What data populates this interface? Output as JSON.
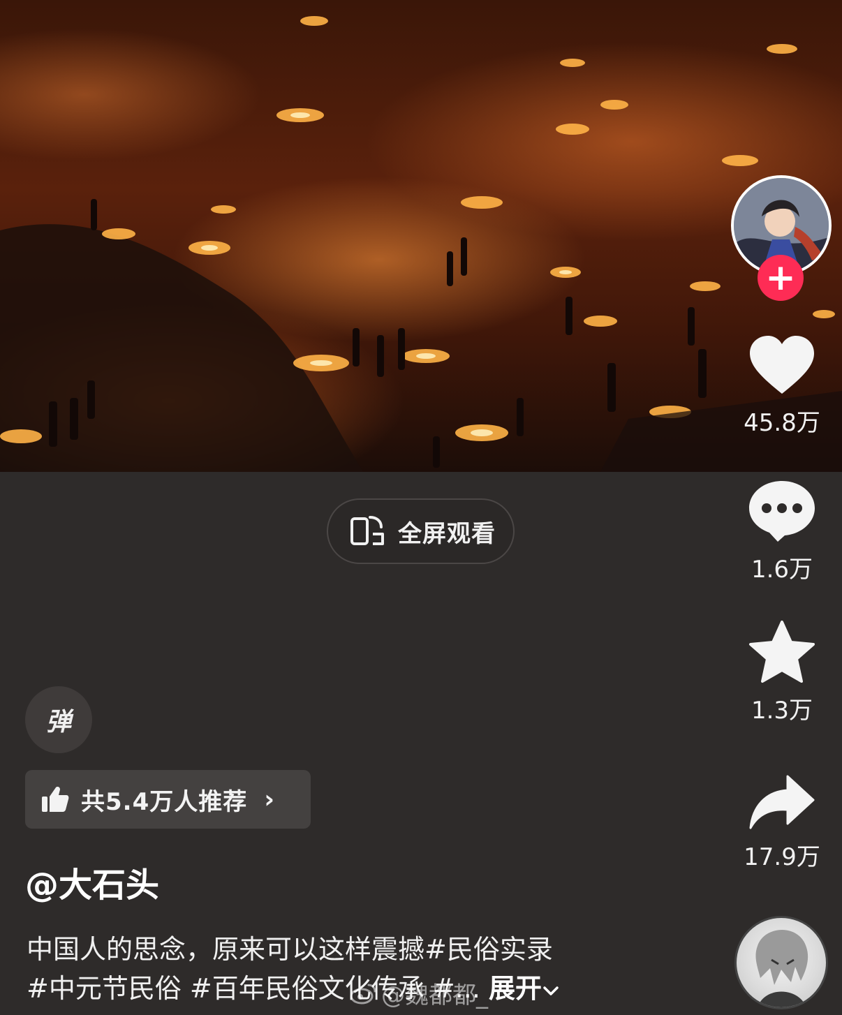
{
  "player": {
    "fullscreen_label": "全屏观看",
    "danmaku_label": "弹"
  },
  "actions": {
    "like_count": "45.8万",
    "comment_count": "1.6万",
    "favorite_count": "1.3万",
    "share_count": "17.9万",
    "follow_symbol": "+"
  },
  "recommend": {
    "label": "共5.4万人推荐",
    "arrow": "›"
  },
  "post": {
    "author": "@大石头",
    "caption_line1": "中国人的思念，原来可以这样震撼#民俗实录",
    "caption_line2": "#中元节民俗 #百年民俗文化传承 #...",
    "expand_label": "展开"
  },
  "watermark": {
    "text": "@魏都都_"
  },
  "colors": {
    "background": "#2e2b2a",
    "follow_red": "#fe2c55",
    "panel": "#444140"
  }
}
